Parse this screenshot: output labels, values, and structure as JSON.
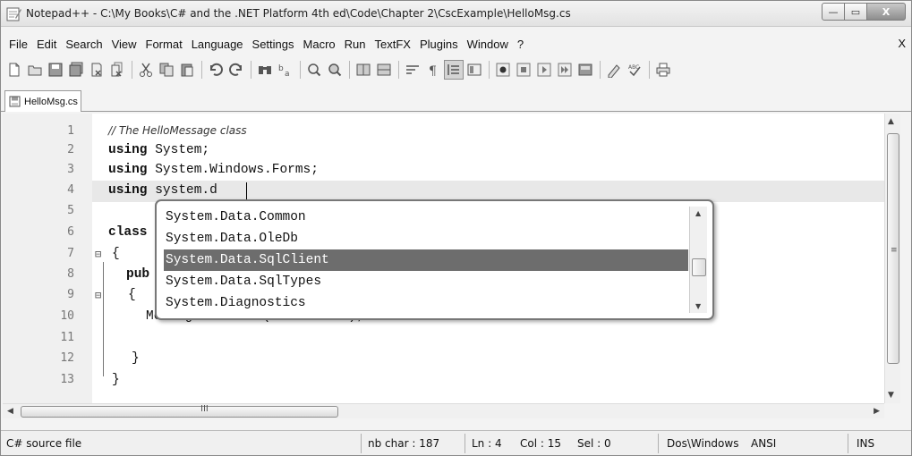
{
  "window": {
    "title": "Notepad++ - C:\\My Books\\C# and the .NET Platform 4th ed\\Code\\Chapter 2\\CscExample\\HelloMsg.cs",
    "close_label": "X",
    "maximize_label": "▭",
    "minimize_label": "—"
  },
  "menu": {
    "items": [
      "File",
      "Edit",
      "Search",
      "View",
      "Format",
      "Language",
      "Settings",
      "Macro",
      "Run",
      "TextFX",
      "Plugins",
      "Window",
      "?"
    ],
    "close_label": "X"
  },
  "toolbar": {
    "icons": [
      "new-file-icon",
      "open-file-icon",
      "save-icon",
      "save-all-icon",
      "close-icon",
      "close-all-icon",
      "cut-icon",
      "copy-icon",
      "paste-icon",
      "undo-icon",
      "redo-icon",
      "find-icon",
      "replace-icon",
      "zoom-in-icon",
      "zoom-out-icon",
      "sync-v-icon",
      "sync-h-icon",
      "wrap-icon",
      "show-all-icon",
      "indent-guide-icon",
      "folder-icon",
      "record-macro-icon",
      "stop-macro-icon",
      "play-macro-icon",
      "run-macro-multiple-icon",
      "save-macro-icon",
      "translate-icon",
      "spellcheck-icon",
      "print-icon"
    ]
  },
  "tab": {
    "label": "HelloMsg.cs"
  },
  "editor": {
    "line_numbers": [
      "1",
      "2",
      "3",
      "4",
      "5",
      "6",
      "7",
      "8",
      "9",
      "10",
      "11",
      "12",
      "13"
    ],
    "lines": [
      "// The HelloMessage class",
      "using System;",
      "using System.Windows.Forms;",
      "using system.d",
      "",
      "class",
      "{",
      "pub",
      "{",
      "MessageBox.Show(\"Hello...\");",
      "",
      "}",
      "}"
    ]
  },
  "autocomplete": {
    "items": [
      "System.Data.Common",
      "System.Data.OleDb",
      "System.Data.SqlClient",
      "System.Data.SqlTypes",
      "System.Diagnostics"
    ],
    "selected": "System.Data.SqlClient"
  },
  "hscroll": {
    "grip": "III"
  },
  "status": {
    "file_type": "C# source file",
    "nb_char": "nb char : 187",
    "ln": "Ln : 4",
    "col": "Col : 15",
    "sel": "Sel : 0",
    "eol": "Dos\\Windows",
    "encoding": "ANSI",
    "mode": "INS"
  }
}
